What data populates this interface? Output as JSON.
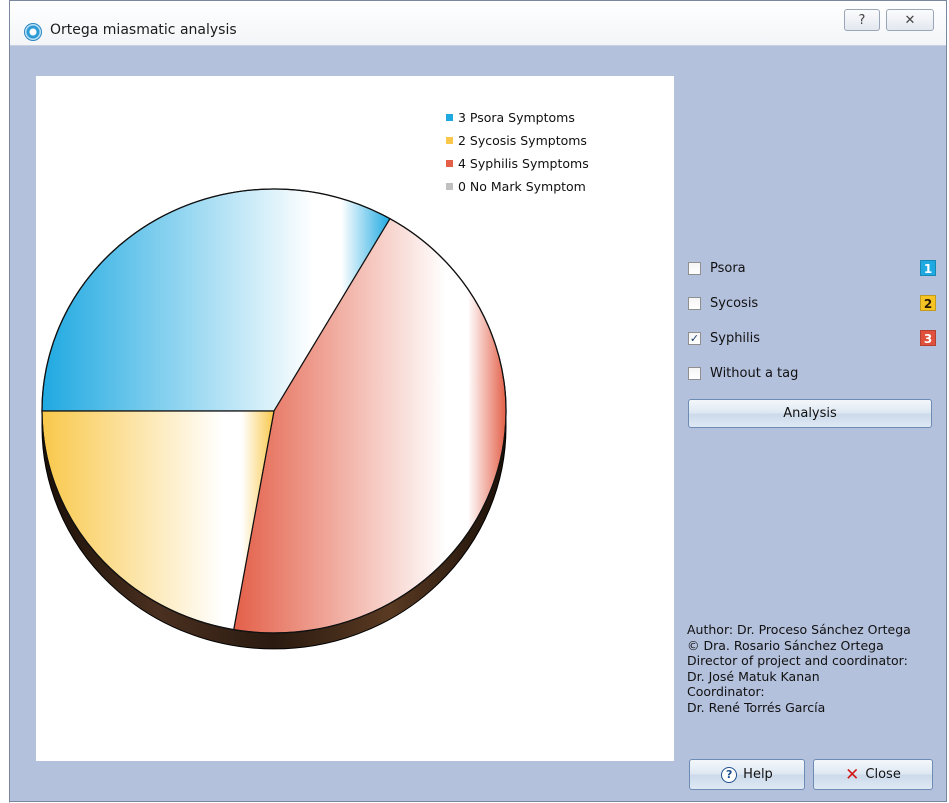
{
  "window": {
    "title": "Ortega miasmatic analysis",
    "help_glyph": "?",
    "close_glyph": "✕"
  },
  "chart_data": {
    "type": "pie",
    "title": "",
    "legend_position": "top-right",
    "slices": [
      {
        "label": "3 Psora Symptoms",
        "value": 3,
        "color": "#1fa9e1"
      },
      {
        "label": "2 Sycosis Symptoms",
        "value": 2,
        "color": "#f9c84b"
      },
      {
        "label": "4 Syphilis Symptoms",
        "value": 4,
        "color": "#e35f48"
      },
      {
        "label": "0 No Mark Symptom",
        "value": 0,
        "color": "#c0c0c0"
      }
    ]
  },
  "options": [
    {
      "label": "Psora",
      "checked": false,
      "badge": "1",
      "badge_color": "#1fa9e1"
    },
    {
      "label": "Sycosis",
      "checked": false,
      "badge": "2",
      "badge_color": "#f6c324"
    },
    {
      "label": "Syphilis",
      "checked": true,
      "badge": "3",
      "badge_color": "#e0503c"
    },
    {
      "label": "Without a tag",
      "checked": false
    }
  ],
  "buttons": {
    "analysis": "Analysis",
    "help": "Help",
    "close": "Close"
  },
  "credits": [
    "Author: Dr. Proceso Sánchez Ortega",
    "© Dra. Rosario Sánchez Ortega",
    "Director of project and coordinator:",
    "Dr. José Matuk Kanan",
    "Coordinator:",
    "Dr. René Torrés García"
  ]
}
